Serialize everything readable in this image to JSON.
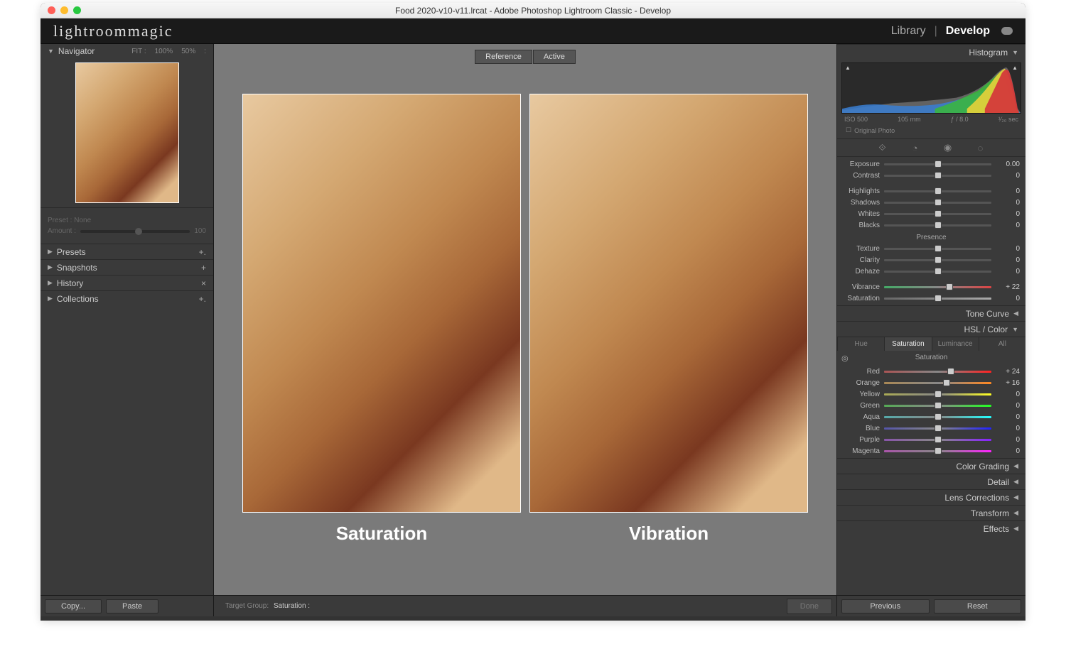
{
  "window": {
    "title": "Food 2020-v10-v11.lrcat - Adobe Photoshop Lightroom Classic - Develop"
  },
  "brand": "lightroommagic",
  "modules": {
    "library": "Library",
    "develop": "Develop"
  },
  "left": {
    "navigator": {
      "title": "Navigator",
      "fit": "FIT :",
      "z100": "100%",
      "z50": "50%"
    },
    "preset_box": {
      "preset_label": "Preset : None",
      "amount_label": "Amount :",
      "amount_value": "100"
    },
    "panels": [
      {
        "title": "Presets",
        "icon": "+."
      },
      {
        "title": "Snapshots",
        "icon": "+"
      },
      {
        "title": "History",
        "icon": "×"
      },
      {
        "title": "Collections",
        "icon": "+."
      }
    ],
    "buttons": {
      "copy": "Copy...",
      "paste": "Paste"
    }
  },
  "center": {
    "compare": {
      "reference": "Reference",
      "active": "Active"
    },
    "labels": {
      "left": "Saturation",
      "right": "Vibration"
    },
    "target_group_label": "Target Group:",
    "target_group_value": "Saturation  :",
    "done": "Done"
  },
  "right": {
    "histogram": {
      "title": "Histogram",
      "iso": "ISO 500",
      "lens": "105 mm",
      "aperture": "ƒ / 8.0",
      "shutter": "¹⁄₂₀ sec",
      "original": "Original Photo"
    },
    "basic": {
      "exposure": {
        "label": "Exposure",
        "value": "0.00",
        "pos": 50
      },
      "contrast": {
        "label": "Contrast",
        "value": "0",
        "pos": 50
      },
      "highlights": {
        "label": "Highlights",
        "value": "0",
        "pos": 50
      },
      "shadows": {
        "label": "Shadows",
        "value": "0",
        "pos": 50
      },
      "whites": {
        "label": "Whites",
        "value": "0",
        "pos": 50
      },
      "blacks": {
        "label": "Blacks",
        "value": "0",
        "pos": 50
      },
      "presence_header": "Presence",
      "texture": {
        "label": "Texture",
        "value": "0",
        "pos": 50
      },
      "clarity": {
        "label": "Clarity",
        "value": "0",
        "pos": 50
      },
      "dehaze": {
        "label": "Dehaze",
        "value": "0",
        "pos": 50
      },
      "vibrance": {
        "label": "Vibrance",
        "value": "+ 22",
        "pos": 61
      },
      "saturation": {
        "label": "Saturation",
        "value": "0",
        "pos": 50
      }
    },
    "tone_curve": "Tone Curve",
    "hsl": {
      "title": "HSL / Color",
      "tabs": {
        "hue": "Hue",
        "saturation": "Saturation",
        "luminance": "Luminance",
        "all": "All"
      },
      "header": "Saturation",
      "colors": [
        {
          "label": "Red",
          "value": "+ 24",
          "pos": 62,
          "c1": "#a55",
          "c2": "#f22"
        },
        {
          "label": "Orange",
          "value": "+ 16",
          "pos": 58,
          "c1": "#a85",
          "c2": "#f82"
        },
        {
          "label": "Yellow",
          "value": "0",
          "pos": 50,
          "c1": "#aa5",
          "c2": "#ff2"
        },
        {
          "label": "Green",
          "value": "0",
          "pos": 50,
          "c1": "#5a5",
          "c2": "#2f2"
        },
        {
          "label": "Aqua",
          "value": "0",
          "pos": 50,
          "c1": "#5aa",
          "c2": "#2ff"
        },
        {
          "label": "Blue",
          "value": "0",
          "pos": 50,
          "c1": "#55a",
          "c2": "#22f"
        },
        {
          "label": "Purple",
          "value": "0",
          "pos": 50,
          "c1": "#85a",
          "c2": "#82f"
        },
        {
          "label": "Magenta",
          "value": "0",
          "pos": 50,
          "c1": "#a5a",
          "c2": "#f2f"
        }
      ]
    },
    "collapsed": [
      "Color Grading",
      "Detail",
      "Lens Corrections",
      "Transform",
      "Effects"
    ],
    "buttons": {
      "previous": "Previous",
      "reset": "Reset"
    }
  }
}
